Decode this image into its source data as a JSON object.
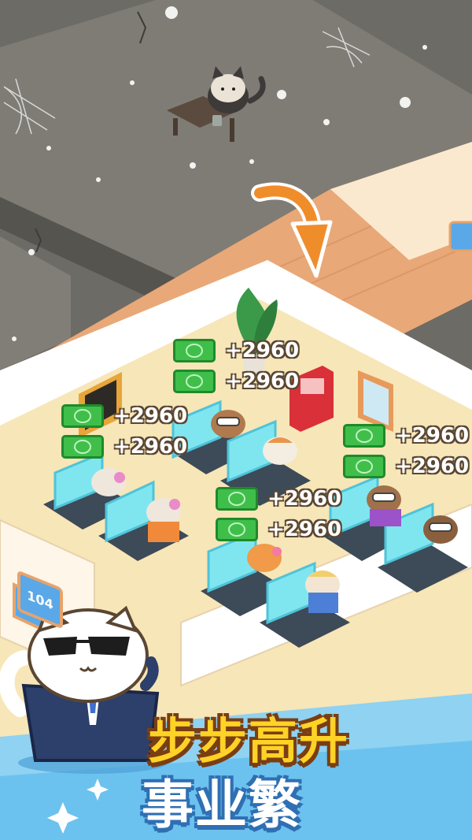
{
  "colors": {
    "dark_room_floor": "#7d7b73",
    "dark_room_wall": "#5a5954",
    "office_floor": "#f7e6b8",
    "office_wall": "#ffffff",
    "brick_path": "#e9a877",
    "sky_blue": "#8fd2f2",
    "money_green": "#3fbf4a",
    "title_yellow": "#ffd226",
    "title_blue_outline": "#2f6fb3"
  },
  "earnings": [
    {
      "label": "+2960"
    },
    {
      "label": "+2960"
    },
    {
      "label": "+2960"
    },
    {
      "label": "+2960"
    },
    {
      "label": "+2960"
    },
    {
      "label": "+2960"
    },
    {
      "label": "+2960"
    },
    {
      "label": "+2960"
    }
  ],
  "room_number": "104",
  "title": {
    "line1": "步步高升",
    "line2": "事业繁"
  },
  "icons": {
    "transition_arrow": "orange-curved-arrow-icon",
    "cat_mascot": "cat-in-suit-sunglasses-icon"
  }
}
